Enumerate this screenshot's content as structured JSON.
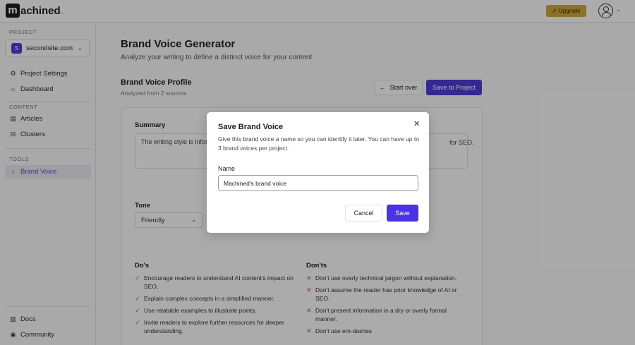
{
  "app": {
    "logo_letter": "m",
    "logo_text": "achined",
    "logo_dot": "."
  },
  "header": {
    "upgrade_label": "Upgrade"
  },
  "sidebar": {
    "project_label": "PROJECT",
    "site": {
      "badge": "S",
      "name": "secondsite.com"
    },
    "top_items": [
      {
        "label": "Project Settings",
        "icon": "gear-icon"
      },
      {
        "label": "Dashboard",
        "icon": "home-icon"
      }
    ],
    "content_label": "CONTENT",
    "content_items": [
      {
        "label": "Articles",
        "icon": "document-icon"
      },
      {
        "label": "Clusters",
        "icon": "folder-icon"
      }
    ],
    "tools_label": "TOOLS",
    "tools_items": [
      {
        "label": "Brand Voice",
        "icon": "microphone-icon",
        "active": true
      }
    ],
    "bottom_items": [
      {
        "label": "Docs",
        "icon": "book-icon"
      },
      {
        "label": "Community",
        "icon": "discord-icon"
      }
    ]
  },
  "main": {
    "title": "Brand Voice Generator",
    "subtitle": "Analyze your writing to define a distinct voice for your content",
    "profile_title": "Brand Voice Profile",
    "profile_sub": "Analyzed from 2 sources",
    "start_over_label": "Start over",
    "save_project_label": "Save to Project",
    "summary_label": "Summary",
    "summary_text": "The writing style is infor",
    "summary_tail": "for SEO.",
    "tone_label": "Tone",
    "tone_value": "Friendly",
    "dos_label": "Do's",
    "dos": [
      "Encourage readers to understand AI content's impact on SEO.",
      "Explain complex concepts in a simplified manner.",
      "Use relatable examples to illustrate points.",
      "Invite readers to explore further resources for deeper understanding."
    ],
    "donts_label": "Don'ts",
    "donts": [
      "Don't use overly technical jargon without explanation.",
      "Don't assume the reader has prior knowledge of AI or SEO.",
      "Don't present information in a dry or overly formal manner.",
      "Don't use em-dashes"
    ]
  },
  "modal": {
    "title": "Save Brand Voice",
    "description": "Give this brand voice a name so you can identify it later. You can have up to 3 brand voices per project.",
    "name_label": "Name",
    "name_value": "Machined's brand voice",
    "cancel_label": "Cancel",
    "save_label": "Save"
  }
}
